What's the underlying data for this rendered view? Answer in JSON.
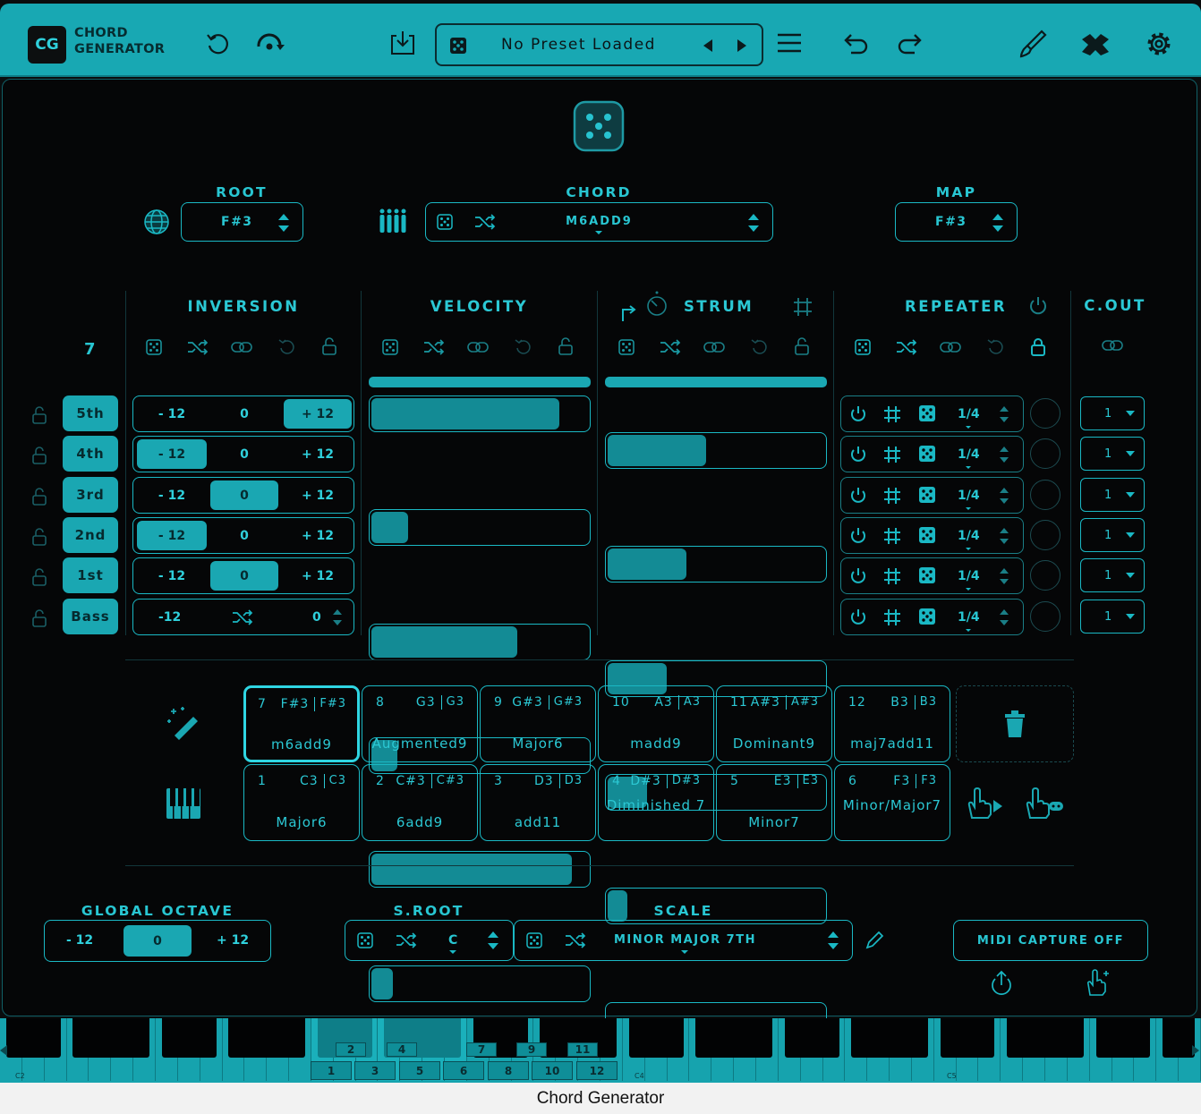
{
  "header": {
    "logo": "CG",
    "app_line1": "CHORD",
    "app_line2": "GENERATOR",
    "preset": "No Preset Loaded"
  },
  "root": {
    "label": "ROOT",
    "value": "F#3"
  },
  "chord": {
    "label": "CHORD",
    "value": "M6ADD9"
  },
  "map": {
    "label": "MAP",
    "value": "F#3"
  },
  "columns": {
    "inversion": "INVERSION",
    "velocity": "VELOCITY",
    "strum": "STRUM",
    "repeater": "REPEATER",
    "cout": "C.OUT"
  },
  "chord_count": "7",
  "voices": [
    {
      "name": "5th",
      "inv_low": "- 12",
      "inv_mid": "0",
      "inv_high": "+ 12",
      "inv_sel": "high",
      "velocity": 0.86,
      "strum": 0.45,
      "rate": "1/4",
      "cout": "1"
    },
    {
      "name": "4th",
      "inv_low": "- 12",
      "inv_mid": "0",
      "inv_high": "+ 12",
      "inv_sel": "low",
      "velocity": 0.17,
      "strum": 0.36,
      "rate": "1/4",
      "cout": "1"
    },
    {
      "name": "3rd",
      "inv_low": "- 12",
      "inv_mid": "0",
      "inv_high": "+ 12",
      "inv_sel": "mid",
      "velocity": 0.67,
      "strum": 0.27,
      "rate": "1/4",
      "cout": "1"
    },
    {
      "name": "2nd",
      "inv_low": "- 12",
      "inv_mid": "0",
      "inv_high": "+ 12",
      "inv_sel": "low",
      "velocity": 0.12,
      "strum": 0.18,
      "rate": "1/4",
      "cout": "1"
    },
    {
      "name": "1st",
      "inv_low": "- 12",
      "inv_mid": "0",
      "inv_high": "+ 12",
      "inv_sel": "mid",
      "velocity": 0.92,
      "strum": 0.09,
      "rate": "1/4",
      "cout": "1"
    },
    {
      "name": "Bass",
      "inv_low": "-12",
      "inv_mid": "",
      "inv_high": "0",
      "inv_sel": "none",
      "velocity": 0.1,
      "strum": 0.0,
      "rate": "1/4",
      "cout": "1"
    }
  ],
  "pads_top": [
    {
      "num": "7",
      "note": "F#3",
      "map": "F#3",
      "name": "m6add9",
      "selected": true
    },
    {
      "num": "8",
      "note": "G3",
      "map": "G3",
      "name": "Augmented9"
    },
    {
      "num": "9",
      "note": "G#3",
      "map": "G#3",
      "name": "Major6"
    },
    {
      "num": "10",
      "note": "A3",
      "map": "A3",
      "name": "madd9"
    },
    {
      "num": "11",
      "note": "A#3",
      "map": "A#3",
      "name": "Dominant9"
    },
    {
      "num": "12",
      "note": "B3",
      "map": "B3",
      "name": "maj7add11"
    }
  ],
  "pads_bottom": [
    {
      "num": "1",
      "note": "C3",
      "map": "C3",
      "name": "Major6"
    },
    {
      "num": "2",
      "note": "C#3",
      "map": "C#3",
      "name": "6add9"
    },
    {
      "num": "3",
      "note": "D3",
      "map": "D3",
      "name": "add11"
    },
    {
      "num": "4",
      "note": "D#3",
      "map": "D#3",
      "name": "Diminished 7"
    },
    {
      "num": "5",
      "note": "E3",
      "map": "E3",
      "name": "Minor7"
    },
    {
      "num": "6",
      "note": "F3",
      "map": "F3",
      "name": "Minor/Major7"
    }
  ],
  "global_octave": {
    "label": "GLOBAL OCTAVE",
    "low": "- 12",
    "mid": "0",
    "high": "+ 12"
  },
  "sroot": {
    "label": "S.ROOT",
    "value": "C"
  },
  "scale": {
    "label": "SCALE",
    "value": "MINOR MAJOR 7TH"
  },
  "midi_capture": "MIDI CAPTURE OFF",
  "keyboard": {
    "octave_labels": [
      "C2",
      "C4",
      "C5"
    ],
    "black_numbers": [
      "2",
      "4",
      "7",
      "9",
      "11"
    ],
    "white_numbers": [
      "1",
      "3",
      "5",
      "6",
      "8",
      "10",
      "12"
    ]
  },
  "window_title": "Chord Generator",
  "colors": {
    "accent": "#1aa7b2",
    "accent_bright": "#28c6d2",
    "background": "#050607"
  }
}
